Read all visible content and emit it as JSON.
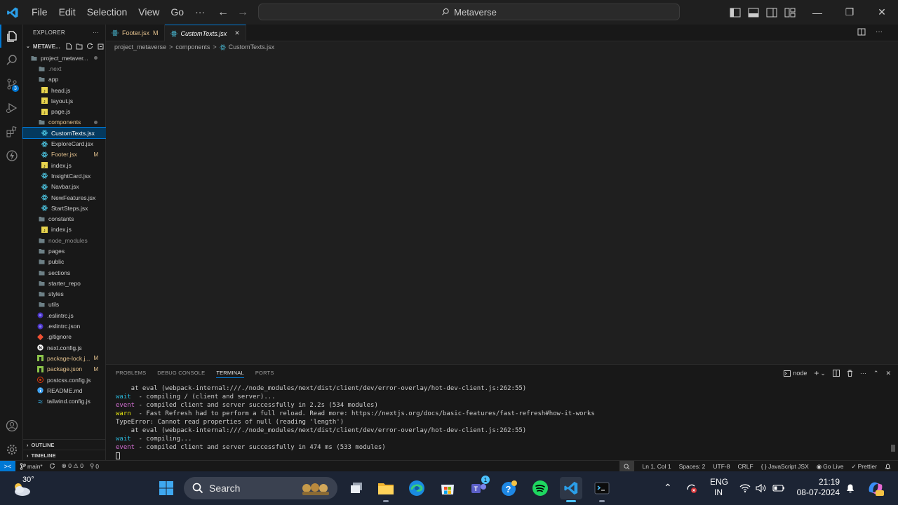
{
  "titlebar": {
    "menu": [
      "File",
      "Edit",
      "Selection",
      "View",
      "Go",
      "···"
    ],
    "search": "Metaverse",
    "controls": [
      "—",
      "❐",
      "✕"
    ]
  },
  "activity": {
    "scm_badge": "3"
  },
  "sidebar": {
    "header": "EXPLORER",
    "header_more": "···",
    "root": "METAVE...",
    "outline": "OUTLINE",
    "timeline": "TIMELINE",
    "tree": [
      {
        "label": "project_metaver...",
        "indent": 0,
        "type": "folder",
        "dot": true
      },
      {
        "label": ".next",
        "indent": 1,
        "type": "folder",
        "dim": true
      },
      {
        "label": "app",
        "indent": 1,
        "type": "folder"
      },
      {
        "label": "head.js",
        "indent": 2,
        "type": "js"
      },
      {
        "label": "layout.js",
        "indent": 2,
        "type": "js"
      },
      {
        "label": "page.js",
        "indent": 2,
        "type": "js"
      },
      {
        "label": "components",
        "indent": 1,
        "type": "folder",
        "color": "yellow",
        "dot": true
      },
      {
        "label": "CustomTexts.jsx",
        "indent": 2,
        "type": "react",
        "selected": true
      },
      {
        "label": "ExploreCard.jsx",
        "indent": 2,
        "type": "react"
      },
      {
        "label": "Footer.jsx",
        "indent": 2,
        "type": "react",
        "color": "yellow",
        "mod": "M"
      },
      {
        "label": "index.js",
        "indent": 2,
        "type": "js"
      },
      {
        "label": "InsightCard.jsx",
        "indent": 2,
        "type": "react"
      },
      {
        "label": "Navbar.jsx",
        "indent": 2,
        "type": "react"
      },
      {
        "label": "NewFeatures.jsx",
        "indent": 2,
        "type": "react"
      },
      {
        "label": "StartSteps.jsx",
        "indent": 2,
        "type": "react"
      },
      {
        "label": "constants",
        "indent": 1,
        "type": "folder"
      },
      {
        "label": "index.js",
        "indent": 2,
        "type": "js"
      },
      {
        "label": "node_modules",
        "indent": 1,
        "type": "folder",
        "dim": true
      },
      {
        "label": "pages",
        "indent": 1,
        "type": "folder"
      },
      {
        "label": "public",
        "indent": 1,
        "type": "folder"
      },
      {
        "label": "sections",
        "indent": 1,
        "type": "folder"
      },
      {
        "label": "starter_repo",
        "indent": 1,
        "type": "folder"
      },
      {
        "label": "styles",
        "indent": 1,
        "type": "folder"
      },
      {
        "label": "utils",
        "indent": 1,
        "type": "folder"
      },
      {
        "label": ".eslintrc.js",
        "indent": 1,
        "type": "eslint"
      },
      {
        "label": ".eslintrc.json",
        "indent": 1,
        "type": "eslint"
      },
      {
        "label": ".gitignore",
        "indent": 1,
        "type": "git"
      },
      {
        "label": "next.config.js",
        "indent": 1,
        "type": "next"
      },
      {
        "label": "package-lock.j...",
        "indent": 1,
        "type": "npm",
        "color": "yellow",
        "mod": "M"
      },
      {
        "label": "package.json",
        "indent": 1,
        "type": "npm",
        "color": "yellow",
        "mod": "M"
      },
      {
        "label": "postcss.config.js",
        "indent": 1,
        "type": "postcss"
      },
      {
        "label": "README.md",
        "indent": 1,
        "type": "info"
      },
      {
        "label": "tailwind.config.js",
        "indent": 1,
        "type": "tailwind"
      }
    ]
  },
  "tabs": [
    {
      "label": "Footer.jsx",
      "mod": "M",
      "active": false
    },
    {
      "label": "CustomTexts.jsx",
      "mod": "✕",
      "active": true
    }
  ],
  "breadcrumb": [
    "project_metaverse",
    ">",
    "components",
    ">",
    "CustomTexts.jsx"
  ],
  "panel": {
    "tabs": [
      "PROBLEMS",
      "DEBUG CONSOLE",
      "TERMINAL",
      "PORTS"
    ],
    "active_tab": "TERMINAL",
    "shell": "node",
    "lines": [
      {
        "prefix": "",
        "text": "    at eval (webpack-internal:///./node_modules/next/dist/client/dev/error-overlay/hot-dev-client.js:262:55)"
      },
      {
        "prefix": "wait",
        "text": "  - compiling / (client and server)..."
      },
      {
        "prefix": "event",
        "text": " - compiled client and server successfully in 2.2s (534 modules)"
      },
      {
        "prefix": "warn",
        "text": "  - Fast Refresh had to perform a full reload. Read more: https://nextjs.org/docs/basic-features/fast-refresh#how-it-works"
      },
      {
        "prefix": "",
        "text": "TypeError: Cannot read properties of null (reading 'length')"
      },
      {
        "prefix": "",
        "text": "    at eval (webpack-internal:///./node_modules/next/dist/client/dev/error-overlay/hot-dev-client.js:262:55)"
      },
      {
        "prefix": "wait",
        "text": "  - compiling..."
      },
      {
        "prefix": "event",
        "text": " - compiled client and server successfully in 474 ms (533 modules)"
      }
    ]
  },
  "statusbar": {
    "remote": "><",
    "branch": "main*",
    "problems": "⊗ 0 ⚠ 0",
    "ports": "0",
    "position": "Ln 1, Col 1",
    "spaces": "Spaces: 2",
    "encoding": "UTF-8",
    "eol": "CRLF",
    "language": "{ } JavaScript JSX",
    "golive": "Go Live",
    "prettier": "Prettier"
  },
  "taskbar": {
    "temperature": "30°",
    "search": "Search",
    "lang_top": "ENG",
    "lang_bottom": "IN",
    "time": "21:19",
    "date": "08-07-2024",
    "teams_badge": "1"
  },
  "colors": {
    "accent": "#0078d4",
    "modified": "#e2c08d",
    "react": "#4ec9e6",
    "js": "#e8d44d"
  }
}
